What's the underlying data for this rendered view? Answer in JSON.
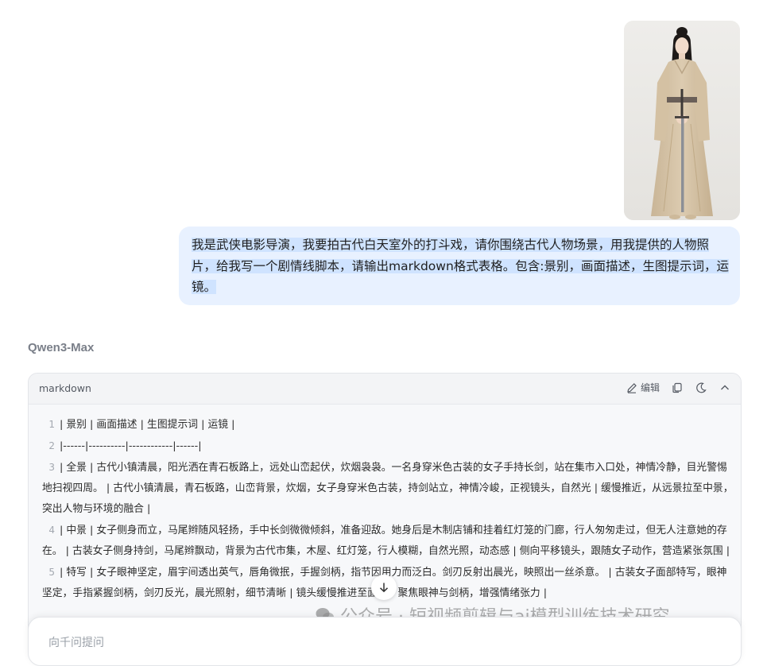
{
  "user_message": {
    "text": "我是武侠电影导演，我要拍古代白天室外的打斗戏，请你围绕古代人物场景，用我提供的人物照片，给我写一个剧情线脚本，请输出markdown格式表格。包含:景别，画面描述，生图提示词，运镜。",
    "attachment_icon": "portrait-image"
  },
  "assistant": {
    "model_name": "Qwen3-Max"
  },
  "code_block": {
    "language": "markdown",
    "edit_label": "编辑",
    "icons": [
      "edit-icon",
      "copy-icon",
      "theme-moon-icon",
      "collapse-chevron-icon"
    ],
    "lines": [
      {
        "num": "1",
        "text": "| 景别 | 画面描述 | 生图提示词 | 运镜 |"
      },
      {
        "num": "2",
        "text": "|------|----------|------------|------|"
      },
      {
        "num": "3",
        "text": "| 全景 | 古代小镇清晨，阳光洒在青石板路上，远处山峦起伏，炊烟袅袅。一名身穿米色古装的女子手持长剑，站在集市入口处，神情冷静，目光警惕地扫视四周。 | 古代小镇清晨，青石板路，山峦背景，炊烟，女子身穿米色古装，持剑站立，神情冷峻，正视镜头，自然光 | 缓慢推近，从远景拉至中景，突出人物与环境的融合 |"
      },
      {
        "num": "4",
        "text": "| 中景 | 女子侧身而立，马尾辫随风轻扬，手中长剑微微倾斜，准备迎敌。她身后是木制店铺和挂着红灯笼的门廊，行人匆匆走过，但无人注意她的存在。 | 古装女子侧身持剑，马尾辫飘动，背景为古代市集，木屋、红灯笼，行人模糊，自然光照，动态感 | 侧向平移镜头，跟随女子动作，营造紧张氛围 |"
      },
      {
        "num": "5",
        "text": "| 特写 | 女子眼神坚定，眉宇间透出英气，唇角微抿，手握剑柄，指节因用力而泛白。剑刃反射出晨光，映照出一丝杀意。 | 古装女子面部特写，眼神坚定，手指紧握剑柄，剑刃反光，晨光照射，细节清晰 | 镜头缓慢推进至面部，聚焦眼神与剑柄，增强情绪张力 |"
      }
    ]
  },
  "input": {
    "placeholder": "向千问提问"
  },
  "watermark": {
    "text": "公众号 · 短视频剪辑与ai模型训练技术研究"
  }
}
